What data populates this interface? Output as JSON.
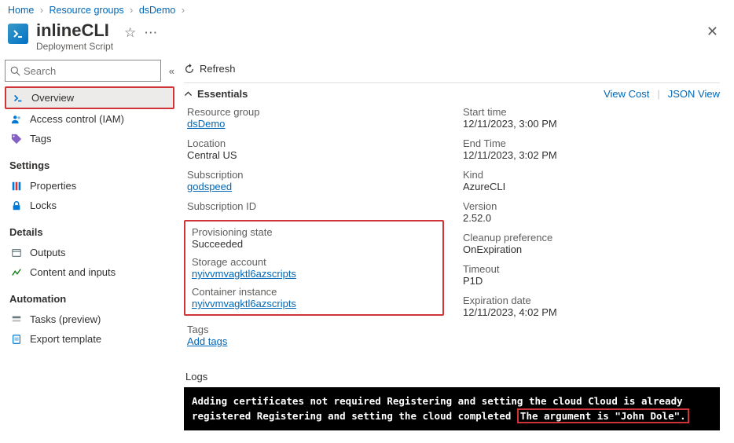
{
  "breadcrumb": {
    "home": "Home",
    "rg": "Resource groups",
    "rgname": "dsDemo"
  },
  "header": {
    "title": "inlineCLI",
    "subtitle": "Deployment Script"
  },
  "search": {
    "placeholder": "Search"
  },
  "nav": {
    "overview": "Overview",
    "iam": "Access control (IAM)",
    "tags": "Tags",
    "settings_group": "Settings",
    "properties": "Properties",
    "locks": "Locks",
    "details_group": "Details",
    "outputs": "Outputs",
    "content": "Content and inputs",
    "automation_group": "Automation",
    "tasks": "Tasks (preview)",
    "export": "Export template"
  },
  "toolbar": {
    "refresh": "Refresh"
  },
  "essentials": {
    "label": "Essentials",
    "viewcost": "View Cost",
    "jsonview": "JSON View",
    "left": {
      "rg_lbl": "Resource group",
      "rg_val": "dsDemo",
      "loc_lbl": "Location",
      "loc_val": "Central US",
      "sub_lbl": "Subscription",
      "sub_val": "godspeed",
      "subid_lbl": "Subscription ID",
      "prov_lbl": "Provisioning state",
      "prov_val": "Succeeded",
      "stor_lbl": "Storage account",
      "stor_val": "nyivvmvagktl6azscripts",
      "ci_lbl": "Container instance",
      "ci_val": "nyivvmvagktl6azscripts",
      "tags_lbl": "Tags",
      "tags_val": "Add tags"
    },
    "right": {
      "start_lbl": "Start time",
      "start_val": "12/11/2023, 3:00 PM",
      "end_lbl": "End Time",
      "end_val": "12/11/2023, 3:02 PM",
      "kind_lbl": "Kind",
      "kind_val": "AzureCLI",
      "ver_lbl": "Version",
      "ver_val": "2.52.0",
      "clean_lbl": "Cleanup preference",
      "clean_val": "OnExpiration",
      "timeout_lbl": "Timeout",
      "timeout_val": "P1D",
      "exp_lbl": "Expiration date",
      "exp_val": "12/11/2023, 4:02 PM"
    }
  },
  "logs": {
    "label": "Logs",
    "text1": "Adding certificates not required Registering and setting the cloud Cloud is already registered Registering and setting the cloud completed ",
    "text2": "The argument is \"John Dole\"."
  }
}
